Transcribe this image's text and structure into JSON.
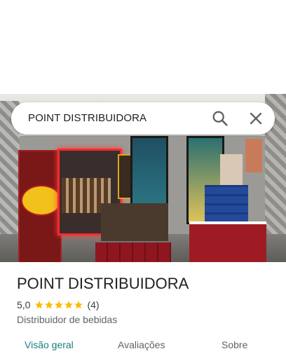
{
  "search": {
    "query": "POINT DISTRIBUIDORA",
    "search_icon": "search-icon",
    "close_icon": "close-icon"
  },
  "place": {
    "name": "POINT DISTRIBUIDORA",
    "rating": "5,0",
    "rating_value": 5,
    "review_count": "(4)",
    "category": "Distribuidor de bebidas"
  },
  "tabs": [
    {
      "label": "Visão geral",
      "active": true
    },
    {
      "label": "Avaliações",
      "active": false
    },
    {
      "label": "Sobre",
      "active": false
    }
  ],
  "colors": {
    "star": "#fbbc04",
    "active_tab": "#1b7c82",
    "inactive_tab": "#5f6368"
  }
}
